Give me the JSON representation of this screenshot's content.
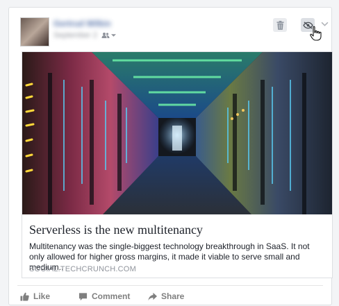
{
  "post": {
    "author": "Gertrud Wilkin",
    "date": "September 2"
  },
  "link_preview": {
    "title": "Serverless is the new multitenancy",
    "description": "Multitenancy was the single-biggest technology breakthrough in SaaS. It not only allowed for higher gross margins, it made it viable to serve small and medium..",
    "domain": "SOCIAL.TECHCRUNCH.COM"
  },
  "actions": {
    "like": "Like",
    "comment": "Comment",
    "share": "Share"
  },
  "icons": {
    "audience": "friends-icon",
    "delete": "trash-icon",
    "hide": "eye-slash-icon",
    "menu": "chevron-down-icon",
    "like": "thumbs-up-icon",
    "comment": "comment-icon",
    "share": "share-arrow-icon"
  },
  "colors": {
    "author_link": "#365899",
    "muted": "#90949c",
    "action": "#7f7f7f"
  }
}
